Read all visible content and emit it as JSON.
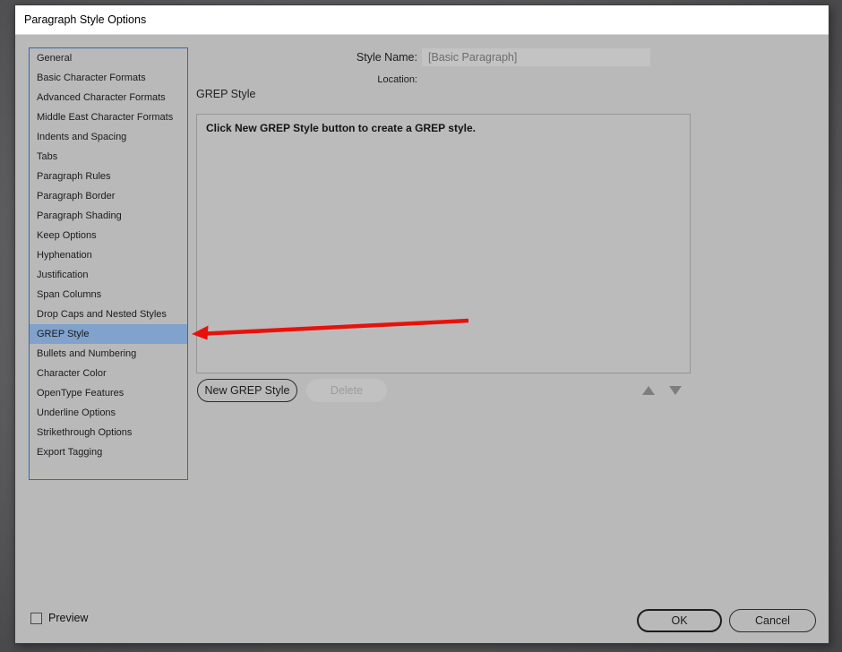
{
  "window": {
    "title": "Paragraph Style Options"
  },
  "sidebar": {
    "items": [
      "General",
      "Basic Character Formats",
      "Advanced Character Formats",
      "Middle East Character Formats",
      "Indents and Spacing",
      "Tabs",
      "Paragraph Rules",
      "Paragraph Border",
      "Paragraph Shading",
      "Keep Options",
      "Hyphenation",
      "Justification",
      "Span Columns",
      "Drop Caps and Nested Styles",
      "GREP Style",
      "Bullets and Numbering",
      "Character Color",
      "OpenType Features",
      "Underline Options",
      "Strikethrough Options",
      "Export Tagging"
    ],
    "selected_index": 14
  },
  "header": {
    "style_name_label": "Style Name:",
    "style_name_value": "[Basic Paragraph]",
    "location_label": "Location:"
  },
  "section": {
    "title": "GREP Style",
    "empty_message": "Click New GREP Style button to create a GREP style."
  },
  "buttons": {
    "new_grep_style": "New GREP Style",
    "delete": "Delete",
    "ok": "OK",
    "cancel": "Cancel"
  },
  "footer": {
    "preview_label": "Preview",
    "preview_checked": false
  },
  "icons": {
    "move_up": "up-triangle",
    "move_down": "down-triangle"
  },
  "colors": {
    "selection_blue": "#80a2cc",
    "sidebar_border_blue": "#2d6bb5",
    "annotation_arrow_red": "#e8120b",
    "dialog_bg": "#b9b9b9",
    "titlebar_bg": "#ffffff",
    "outer_bg": "#5e5e60",
    "disabled_text": "#9c9c9c"
  }
}
